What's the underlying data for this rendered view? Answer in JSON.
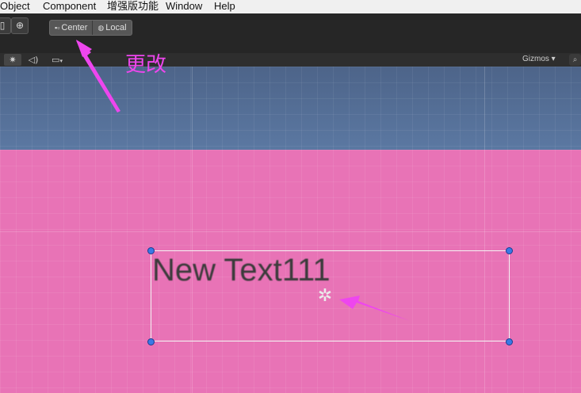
{
  "menu": {
    "items": [
      "Object",
      "Component",
      "增强版功能",
      "Window",
      "Help"
    ]
  },
  "toolbar": {
    "pivot_center_label": "Center",
    "pivot_local_label": "Local"
  },
  "scene_bar": {
    "gizmos_label": "Gizmos ▾"
  },
  "scene": {
    "text_content": "New Text111"
  },
  "annotation": {
    "text": "更改"
  },
  "colors": {
    "canvas_bg": "#e873b6",
    "sky_top": "#4d6489",
    "arrow": "#ee46ee",
    "handle": "#3a79e6"
  }
}
